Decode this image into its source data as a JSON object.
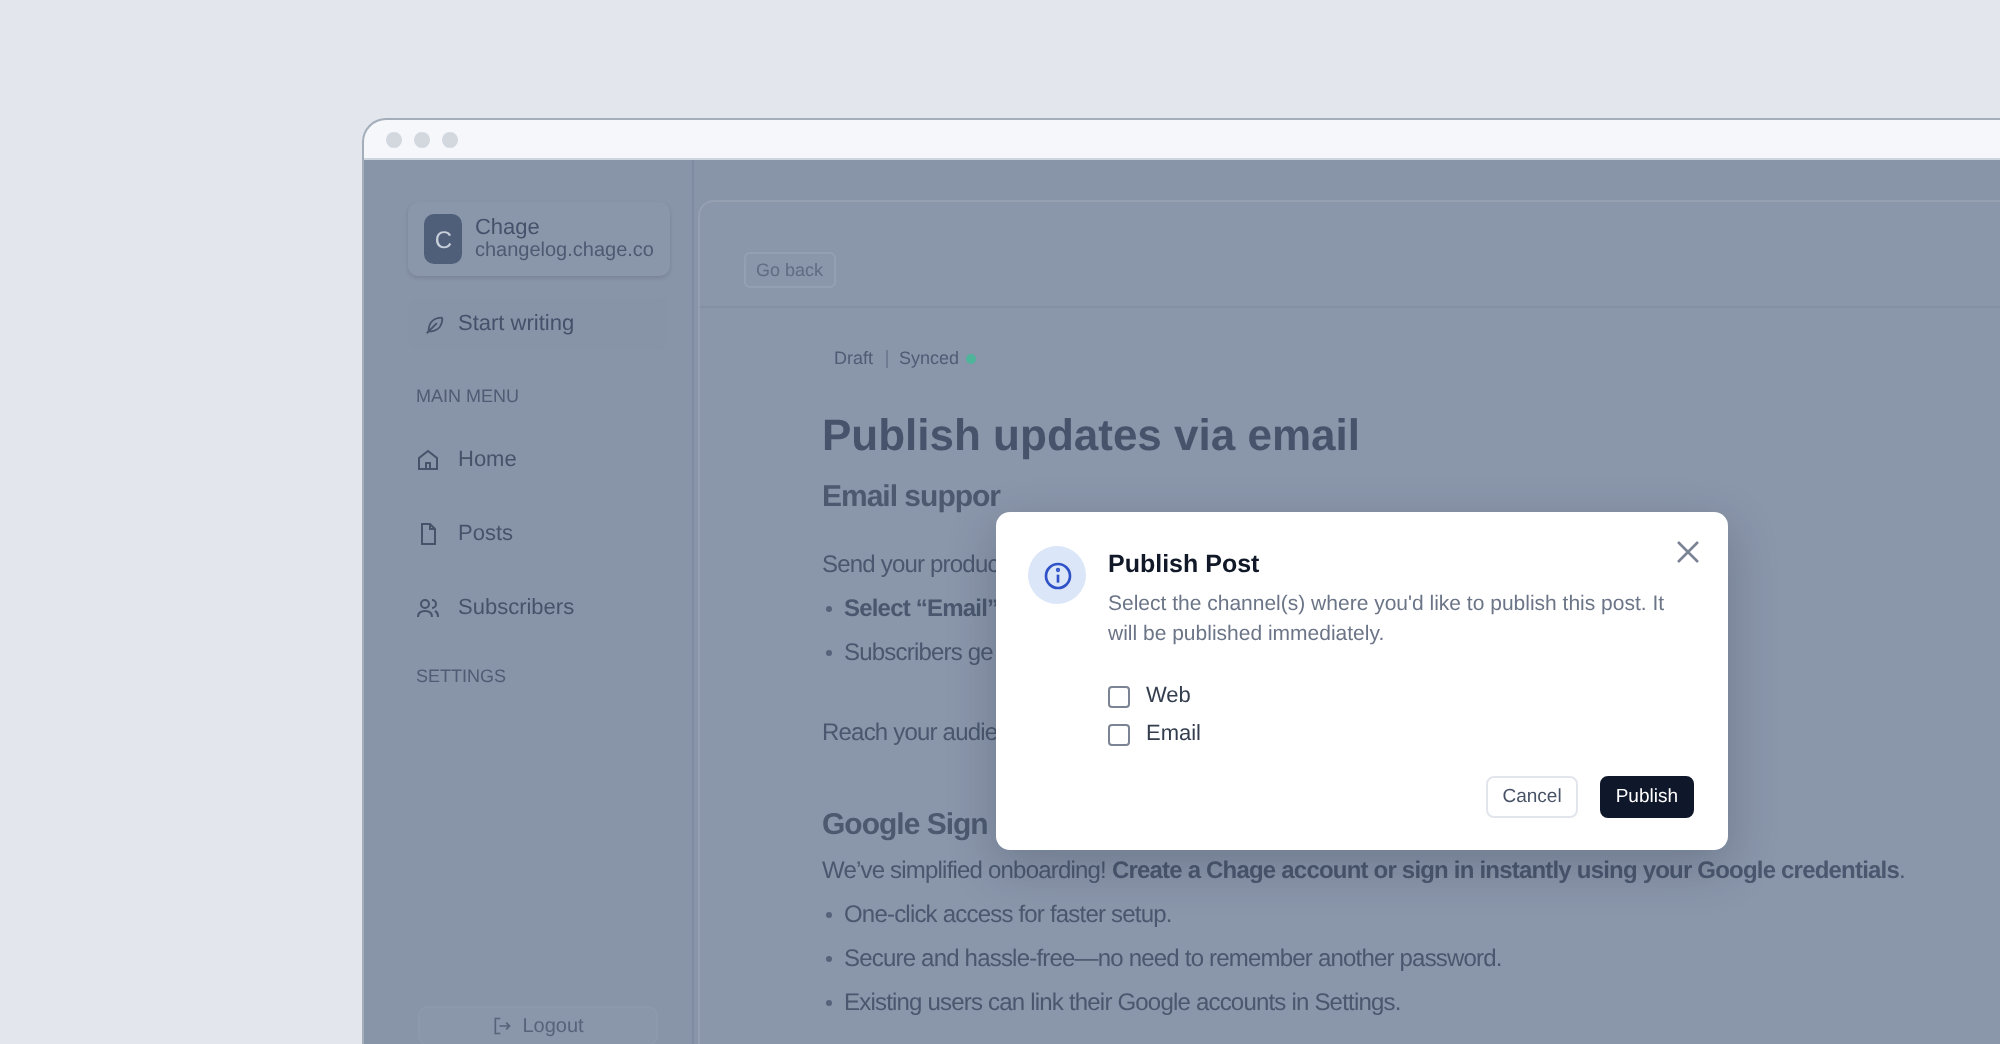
{
  "sidebar": {
    "workspace": {
      "initial": "C",
      "name": "Chage",
      "domain": "changelog.chage.co"
    },
    "new_post_button": "Start writing",
    "main_menu": {
      "title": "MAIN MENU",
      "items": [
        {
          "label": "Home",
          "kind": "home",
          "selected": false
        },
        {
          "label": "Posts",
          "kind": "posts",
          "selected": false
        },
        {
          "label": "Subscribers",
          "kind": "subscribers",
          "selected": false
        }
      ]
    },
    "settings_title": "SETTINGS",
    "logout_button": "Logout"
  },
  "editor": {
    "back_button": "Go back",
    "status": {
      "label": "Draft",
      "sync": "Synced",
      "synced": true
    },
    "title": "Publish updates via email",
    "blocks": [
      {
        "kind": "heading",
        "text": "Email suppor"
      },
      {
        "kind": "paragraph",
        "text": "Send your produc"
      },
      {
        "kind": "bullet",
        "text": "**Select “Email”**"
      },
      {
        "kind": "bullet",
        "text": "Subscribers ge"
      },
      {
        "kind": "paragraph",
        "text": "Reach your audie"
      },
      {
        "kind": "heading",
        "text": "Google Sign"
      },
      {
        "kind": "paragraph",
        "text": "We’ve simplified onboarding! **Create a Chage account or sign in instantly using your Google credentials**."
      },
      {
        "kind": "bullet",
        "text": "One-click access for faster setup."
      },
      {
        "kind": "bullet",
        "text": "Secure and hassle-free—no need to remember another password."
      },
      {
        "kind": "bullet",
        "text": "Existing users can link their Google accounts in Settings."
      }
    ]
  },
  "dialog": {
    "title": "Publish Post",
    "message": "Select the channel(s) where you'd like to publish this post. It will be published immediately.",
    "options": [
      {
        "label": "Web",
        "checked": false
      },
      {
        "label": "Email",
        "checked": false
      }
    ],
    "buttons": [
      {
        "label": "Cancel",
        "kind": "secondary"
      },
      {
        "label": "Publish",
        "kind": "primary"
      }
    ]
  }
}
